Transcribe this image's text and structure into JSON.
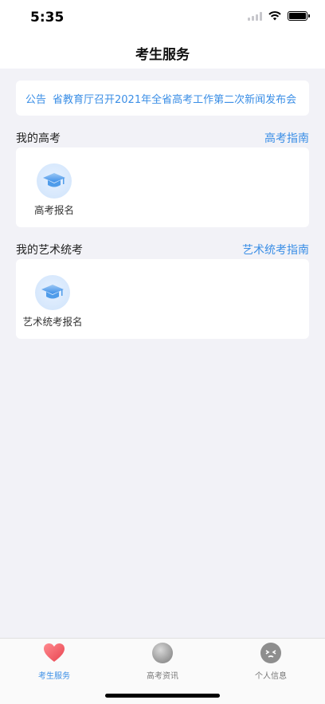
{
  "status": {
    "time": "5:35"
  },
  "header": {
    "title": "考生服务"
  },
  "notice": {
    "tag": "公告",
    "text": "省教育厅召开2021年全省高考工作第二次新闻发布会"
  },
  "gaokao": {
    "title": "我的高考",
    "link": "高考指南",
    "items": [
      {
        "label": "高考报名",
        "icon": "graduation-cap-icon"
      }
    ]
  },
  "art": {
    "title": "我的艺术统考",
    "link": "艺术统考指南",
    "items": [
      {
        "label": "艺术统考报名",
        "icon": "graduation-cap-icon"
      }
    ]
  },
  "tabbar": {
    "tabs": [
      {
        "label": "考生服务",
        "icon": "heart-icon",
        "active": true
      },
      {
        "label": "高考资讯",
        "icon": "info-sphere-icon",
        "active": false
      },
      {
        "label": "个人信息",
        "icon": "profile-face-icon",
        "active": false
      }
    ]
  },
  "colors": {
    "accent": "#3a8ee6",
    "background": "#f2f2f7",
    "heart": "#f0606e"
  }
}
